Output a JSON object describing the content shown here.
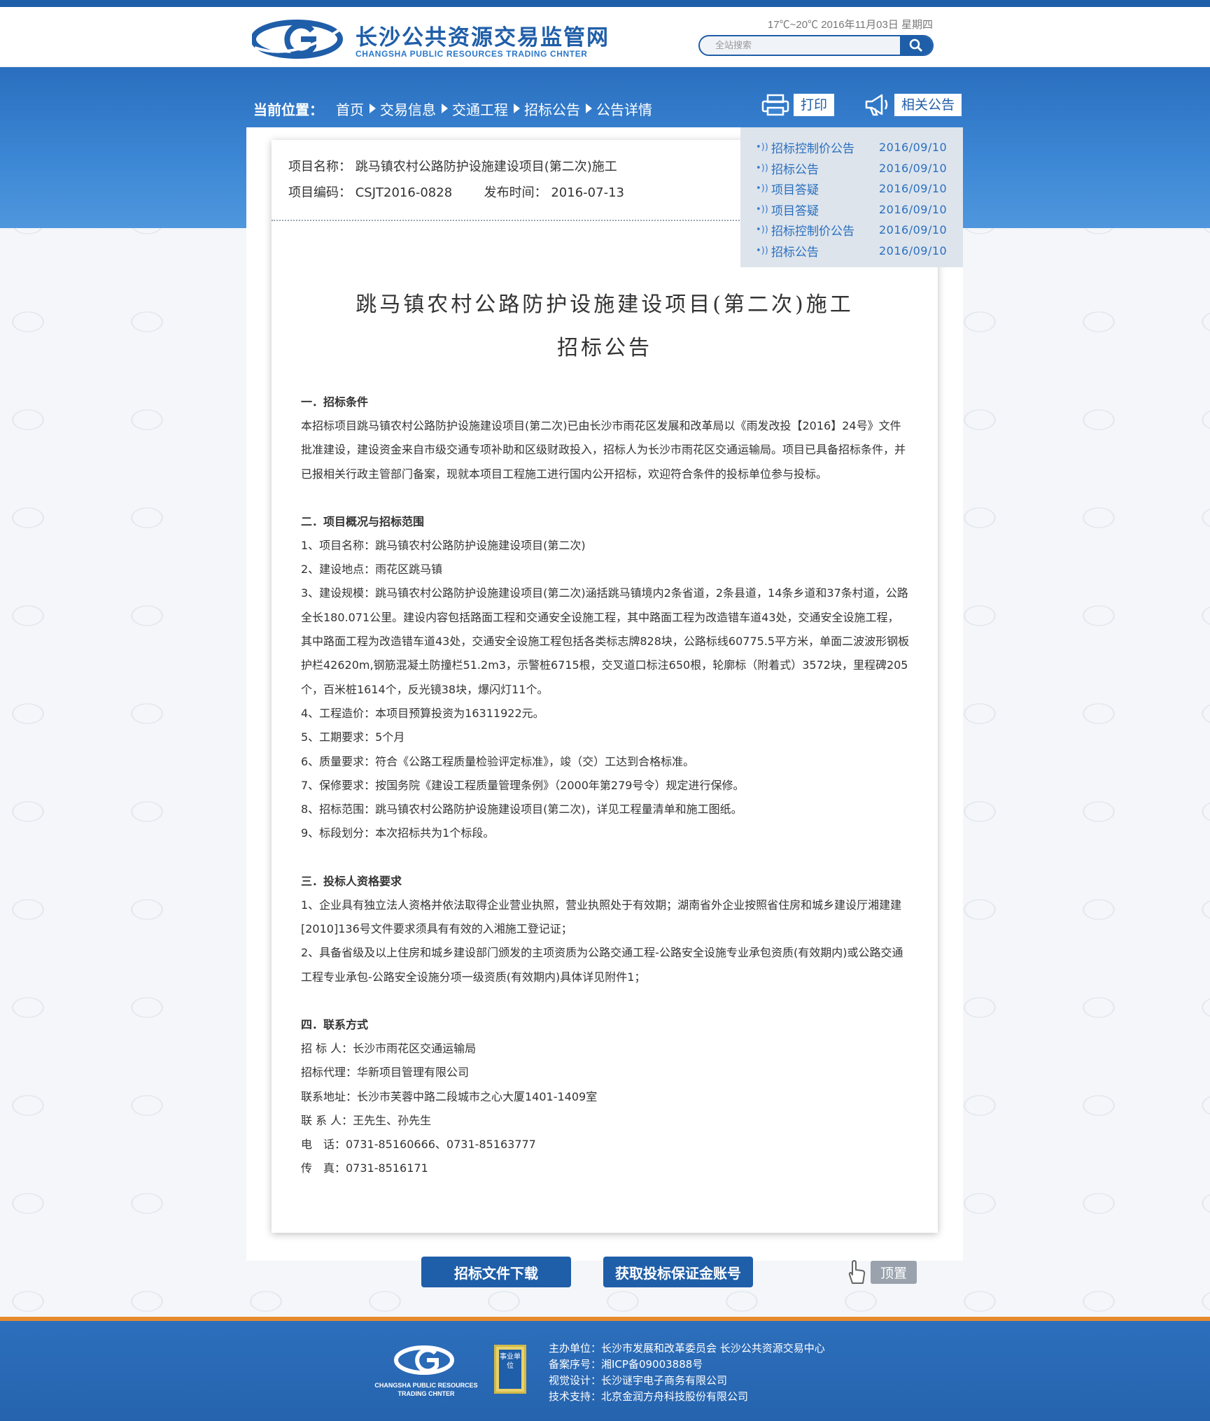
{
  "header": {
    "logo_cn": "长沙公共资源交易监管网",
    "logo_en": "CHANGSHA PUBLIC RESOURCES TRADING CHNTER",
    "weather": "17℃~20℃ 2016年11月03日 星期四",
    "search_placeholder": "全站搜索"
  },
  "breadcrumb": {
    "label": "当前位置：",
    "items": [
      "首页",
      "交易信息",
      "交通工程",
      "招标公告",
      "公告详情"
    ]
  },
  "actions": {
    "print": "打印",
    "related": "相关公告"
  },
  "related": [
    {
      "title": "招标控制价公告",
      "date": "2016/09/10"
    },
    {
      "title": "招标公告",
      "date": "2016/09/10"
    },
    {
      "title": "项目答疑",
      "date": "2016/09/10"
    },
    {
      "title": "项目答疑",
      "date": "2016/09/10"
    },
    {
      "title": "招标控制价公告",
      "date": "2016/09/10"
    },
    {
      "title": "招标公告",
      "date": "2016/09/10"
    }
  ],
  "meta": {
    "name_label": "项目名称：",
    "name_value": "跳马镇农村公路防护设施建设项目(第二次)施工",
    "code_label": "项目编码：",
    "code_value": "CSJT2016-0828",
    "time_label": "发布时间：",
    "time_value": "2016-07-13"
  },
  "doc": {
    "title_line1": "跳马镇农村公路防护设施建设项目(第二次)施工",
    "title_line2": "招标公告",
    "s1_heading": "一．招标条件",
    "s1_para": "本招标项目跳马镇农村公路防护设施建设项目(第二次)已由长沙市雨花区发展和改革局以《雨发改投【2016】24号》文件批准建设，建设资金来自市级交通专项补助和区级财政投入，招标人为长沙市雨花区交通运输局。项目已具备招标条件，并已报相关行政主管部门备案，现就本项目工程施工进行国内公开招标，欢迎符合条件的投标单位参与投标。",
    "s2_heading": "二．项目概况与招标范围",
    "s2_items": [
      "1、项目名称：跳马镇农村公路防护设施建设项目(第二次)",
      "2、建设地点：雨花区跳马镇",
      "3、建设规模：跳马镇农村公路防护设施建设项目(第二次)涵括跳马镇境内2条省道，2条县道，14条乡道和37条村道，公路全长180.071公里。建设内容包括路面工程和交通安全设施工程，其中路面工程为改造错车道43处，交通安全设施工程，其中路面工程为改造错车道43处，交通安全设施工程包括各类标志牌828块，公路标线60775.5平方米，单面二波波形钢板护栏42620m,钢筋混凝土防撞栏51.2m3，示警桩6715根，交叉道口标注650根，轮廓标（附着式）3572块，里程碑205个，百米桩1614个，反光镜38块，爆闪灯11个。",
      "4、工程造价：本项目预算投资为16311922元。",
      "5、工期要求：5个月",
      "6、质量要求：符合《公路工程质量检验评定标准》，竣（交）工达到合格标准。",
      "7、保修要求：按国务院《建设工程质量管理条例》（2000年第279号令）规定进行保修。",
      "8、招标范围：跳马镇农村公路防护设施建设项目(第二次)，详见工程量清单和施工图纸。",
      "9、标段划分：本次招标共为1个标段。"
    ],
    "s3_heading": "三．投标人资格要求",
    "s3_items": [
      "1、企业具有独立法人资格并依法取得企业营业执照，营业执照处于有效期；湖南省外企业按照省住房和城乡建设厅湘建建[2010]136号文件要求须具有有效的入湘施工登记证；",
      "2、具备省级及以上住房和城乡建设部门颁发的主项资质为公路交通工程-公路安全设施专业承包资质(有效期内)或公路交通工程专业承包-公路安全设施分项一级资质(有效期内)具体详见附件1；"
    ],
    "s4_heading": "四．联系方式",
    "s4_items": [
      "招 标 人：长沙市雨花区交通运输局",
      "招标代理：华新项目管理有限公司",
      "联系地址：长沙市芙蓉中路二段城市之心大厦1401-1409室",
      "联 系 人：王先生、孙先生",
      "电　话：0731-85160666、0731-85163777",
      "传　真：0731-8516171"
    ]
  },
  "buttons": {
    "download": "招标文件下载",
    "deposit": "获取投标保证金账号",
    "top": "顶置"
  },
  "footer": {
    "logo_en_line1": "CHANGSHA PUBLIC RESOURCES",
    "logo_en_line2": "TRADING CHNTER",
    "badge": "事业单位",
    "lines": [
      "主办单位：长沙市发展和改革委员会 长沙公共资源交易中心",
      "备案序号：湘ICP备09003888号",
      "视觉设计：长沙谜宇电子商务有限公司",
      "技术支持：北京金润方舟科技股份有限公司"
    ]
  },
  "colors": {
    "brand_blue": "#1f5ea8",
    "accent_orange": "#e68a2e"
  }
}
